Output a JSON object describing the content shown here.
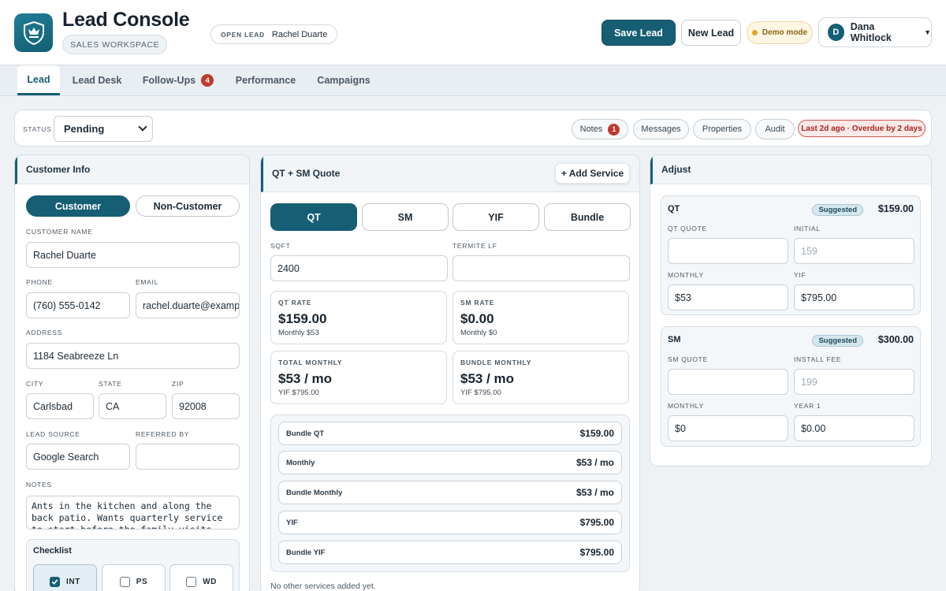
{
  "header": {
    "title": "Lead Console",
    "workspace": "SALES WORKSPACE",
    "open_lead_label": "OPEN LEAD",
    "open_lead_name": "Rachel Duarte",
    "save_label": "Save Lead",
    "new_label": "New Lead",
    "demo_label": "Demo mode",
    "user_initial": "D",
    "user_name": "Dana Whitlock"
  },
  "tabs": [
    {
      "label": "Lead"
    },
    {
      "label": "Lead Desk"
    },
    {
      "label": "Follow-Ups",
      "badge": "4"
    },
    {
      "label": "Performance"
    },
    {
      "label": "Campaigns"
    }
  ],
  "status": {
    "label": "STATUS",
    "value": "Pending",
    "chips": [
      {
        "label": "Notes",
        "badge": "1"
      },
      {
        "label": "Messages"
      },
      {
        "label": "Properties"
      },
      {
        "label": "Audit"
      }
    ],
    "overdue": "Last 2d ago · Overdue by 2 days"
  },
  "customer": {
    "title": "Customer Info",
    "toggle": [
      "Customer",
      "Non-Customer"
    ],
    "name_label": "CUSTOMER NAME",
    "name": "Rachel Duarte",
    "phone_label": "PHONE",
    "phone": "(760) 555-0142",
    "email_label": "EMAIL",
    "email": "rachel.duarte@example",
    "address_label": "ADDRESS",
    "address": "1184 Seabreeze Ln",
    "city_label": "CITY",
    "city": "Carlsbad",
    "state_label": "STATE",
    "state": "CA",
    "zip_label": "ZIP",
    "zip": "92008",
    "source_label": "LEAD SOURCE",
    "source": "Google Search",
    "referred_label": "REFERRED BY",
    "referred": "",
    "notes_label": "NOTES",
    "notes": "Ants in the kitchen and along the back patio. Wants quarterly service to start before the family visits.",
    "checklist_title": "Checklist",
    "checklist": [
      {
        "label": "INT",
        "checked": true
      },
      {
        "label": "PS",
        "checked": false
      },
      {
        "label": "WD",
        "checked": false
      }
    ]
  },
  "quote": {
    "title": "QT + SM Quote",
    "add_service": "+ Add Service",
    "tabs": [
      "QT",
      "SM",
      "YIF",
      "Bundle"
    ],
    "sqft_label": "SQFT",
    "sqft": "2400",
    "termite_label": "TERMITE LF",
    "termite": "",
    "cards": [
      {
        "label": "QT RATE",
        "value": "$159.00",
        "sub": "Monthly $53"
      },
      {
        "label": "SM RATE",
        "value": "$0.00",
        "sub": "Monthly $0"
      },
      {
        "label": "TOTAL MONTHLY",
        "value": "$53 / mo",
        "sub": "YIF $795.00"
      },
      {
        "label": "BUNDLE MONTHLY",
        "value": "$53 / mo",
        "sub": "YIF $795.00"
      }
    ],
    "summary": [
      {
        "label": "Bundle QT",
        "value": "$159.00"
      },
      {
        "label": "Monthly",
        "value": "$53 / mo"
      },
      {
        "label": "Bundle Monthly",
        "value": "$53 / mo"
      },
      {
        "label": "YIF",
        "value": "$795.00"
      },
      {
        "label": "Bundle YIF",
        "value": "$795.00"
      }
    ],
    "no_services": "No other services added yet."
  },
  "adjust": {
    "title": "Adjust",
    "qt": {
      "title": "QT",
      "suggested_label": "Suggested",
      "suggested_value": "$159.00",
      "quote_label": "QT QUOTE",
      "quote": "",
      "initial_label": "INITIAL",
      "initial_placeholder": "159",
      "monthly_label": "MONTHLY",
      "monthly": "$53",
      "yif_label": "YIF",
      "yif": "$795.00"
    },
    "sm": {
      "title": "SM",
      "suggested_label": "Suggested",
      "suggested_value": "$300.00",
      "quote_label": "SM QUOTE",
      "quote": "",
      "install_label": "INSTALL FEE",
      "install_placeholder": "199",
      "monthly_label": "MONTHLY",
      "monthly": "$0",
      "year1_label": "YEAR 1",
      "year1": "$0.00"
    }
  },
  "colors": {
    "accent": "#165e74",
    "badge": "#c0392b",
    "overdue": "#a5231b",
    "demo": "#e4a222"
  }
}
